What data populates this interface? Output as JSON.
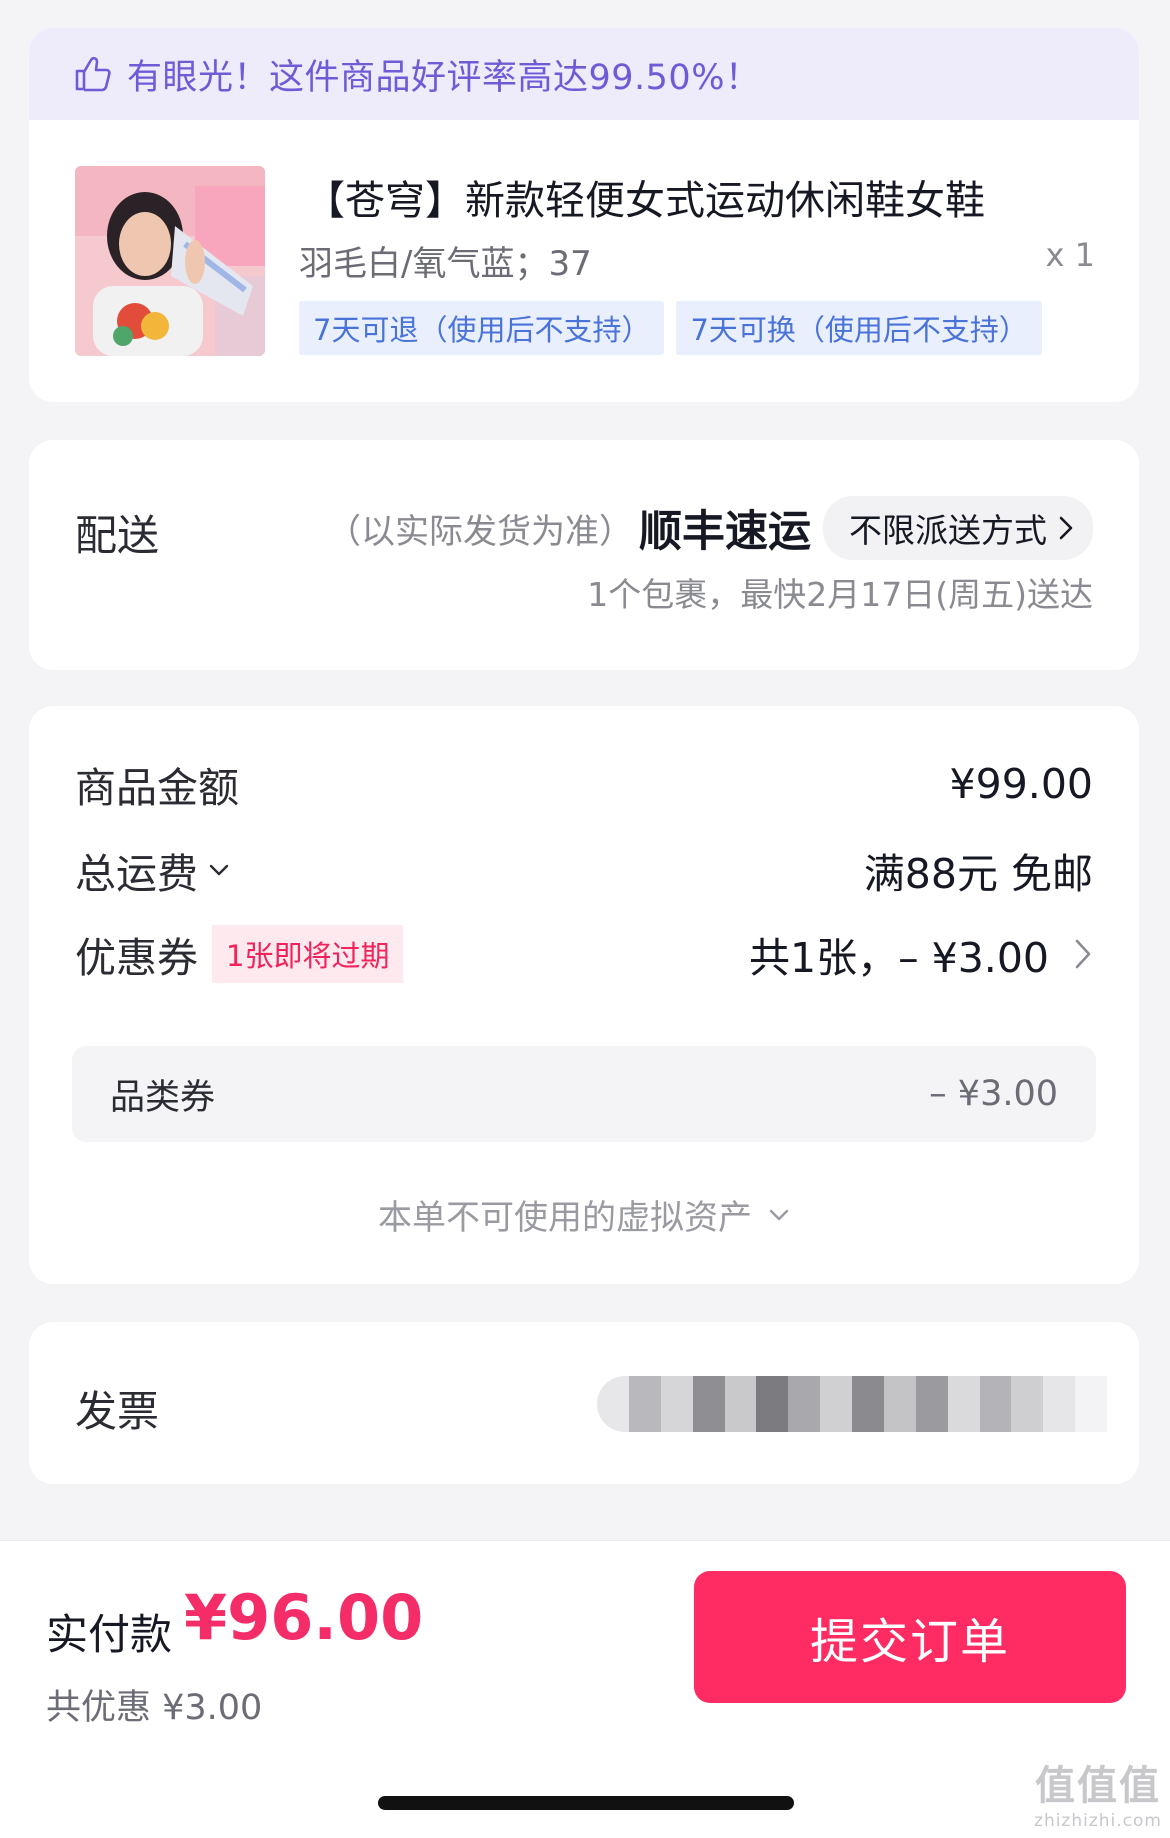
{
  "product_card": {
    "promo_text": "有眼光！这件商品好评率高达99.50%！",
    "title": "【苍穹】新款轻便女式运动休闲鞋女鞋",
    "spec": "羽毛白/氧气蓝；37",
    "quantity": "x 1",
    "policy_tags": [
      "7天可退（使用后不支持）",
      "7天可换（使用后不支持）"
    ]
  },
  "shipping": {
    "label": "配送",
    "note": "（以实际发货为准）",
    "carrier": "顺丰速运",
    "method": "不限派送方式",
    "eta": "1个包裹，最快2月17日(周五)送达"
  },
  "price": {
    "goods_label": "商品金额",
    "goods_value": "¥99.00",
    "freight_label": "总运费",
    "freight_value": "满88元 免邮",
    "coupon_label": "优惠券",
    "coupon_badge": "1张即将过期",
    "coupon_value": "共1张，– ¥3.00",
    "coupon_detail_name": "品类券",
    "coupon_detail_amount": "– ¥3.00",
    "virtual_assets": "本单不可使用的虚拟资产"
  },
  "invoice": {
    "label": "发票"
  },
  "bottom_bar": {
    "pay_label": "实付款",
    "pay_amount": "¥96.00",
    "discount": "共优惠 ¥3.00",
    "submit_label": "提交订单"
  },
  "watermark": {
    "main": "值值值",
    "url": "zhizhizhi.com"
  },
  "colors": {
    "accent": "#fe2c63",
    "promo": "#6f5bd6",
    "policy": "#4a73d9"
  },
  "icons": [
    "thumbs-up-icon",
    "chevron-right-icon",
    "chevron-down-icon"
  ]
}
